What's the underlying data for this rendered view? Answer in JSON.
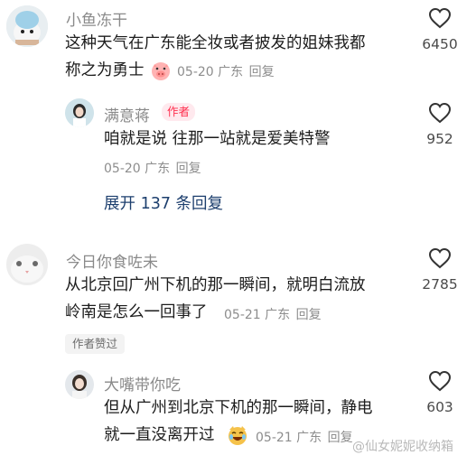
{
  "comments": [
    {
      "name": "小鱼冻干",
      "line1": "这种天气在广东能全妆或者披发的姐妹我都",
      "line2": "称之为勇士",
      "emoji_icon": "pig-face-emoji",
      "date": "05-20",
      "location": "广东",
      "reply_label": "回复",
      "likes": "6450"
    },
    {
      "name": "满意蒋",
      "author_tag": "作者",
      "line1": "咱就是说 往那一站就是爱美特警",
      "date": "05-20",
      "location": "广东",
      "reply_label": "回复",
      "likes": "952"
    },
    {
      "name": "今日你食咗未",
      "line1": "从北京回广州下机的那一瞬间，就明白流放",
      "line2": "岭南是怎么一回事了",
      "date": "05-21",
      "location": "广东",
      "reply_label": "回复",
      "likes": "2785",
      "liked_tag": "作者赞过"
    },
    {
      "name": "大嘴带你吃",
      "line1": "但从广州到北京下机的那一瞬间，静电",
      "line2": "就一直没离开过",
      "emoji_icon": "laughing-cat-emoji",
      "date": "05-21",
      "location": "广东",
      "reply_label": "回复",
      "likes": "603"
    }
  ],
  "expand": {
    "label": "展开 137 条回复"
  },
  "watermark": "@仙女妮妮收纳箱",
  "colors": {
    "author_red": "#ff2e4d",
    "expand_blue": "#1d3f6e",
    "meta_gray": "#8d8d8d"
  }
}
